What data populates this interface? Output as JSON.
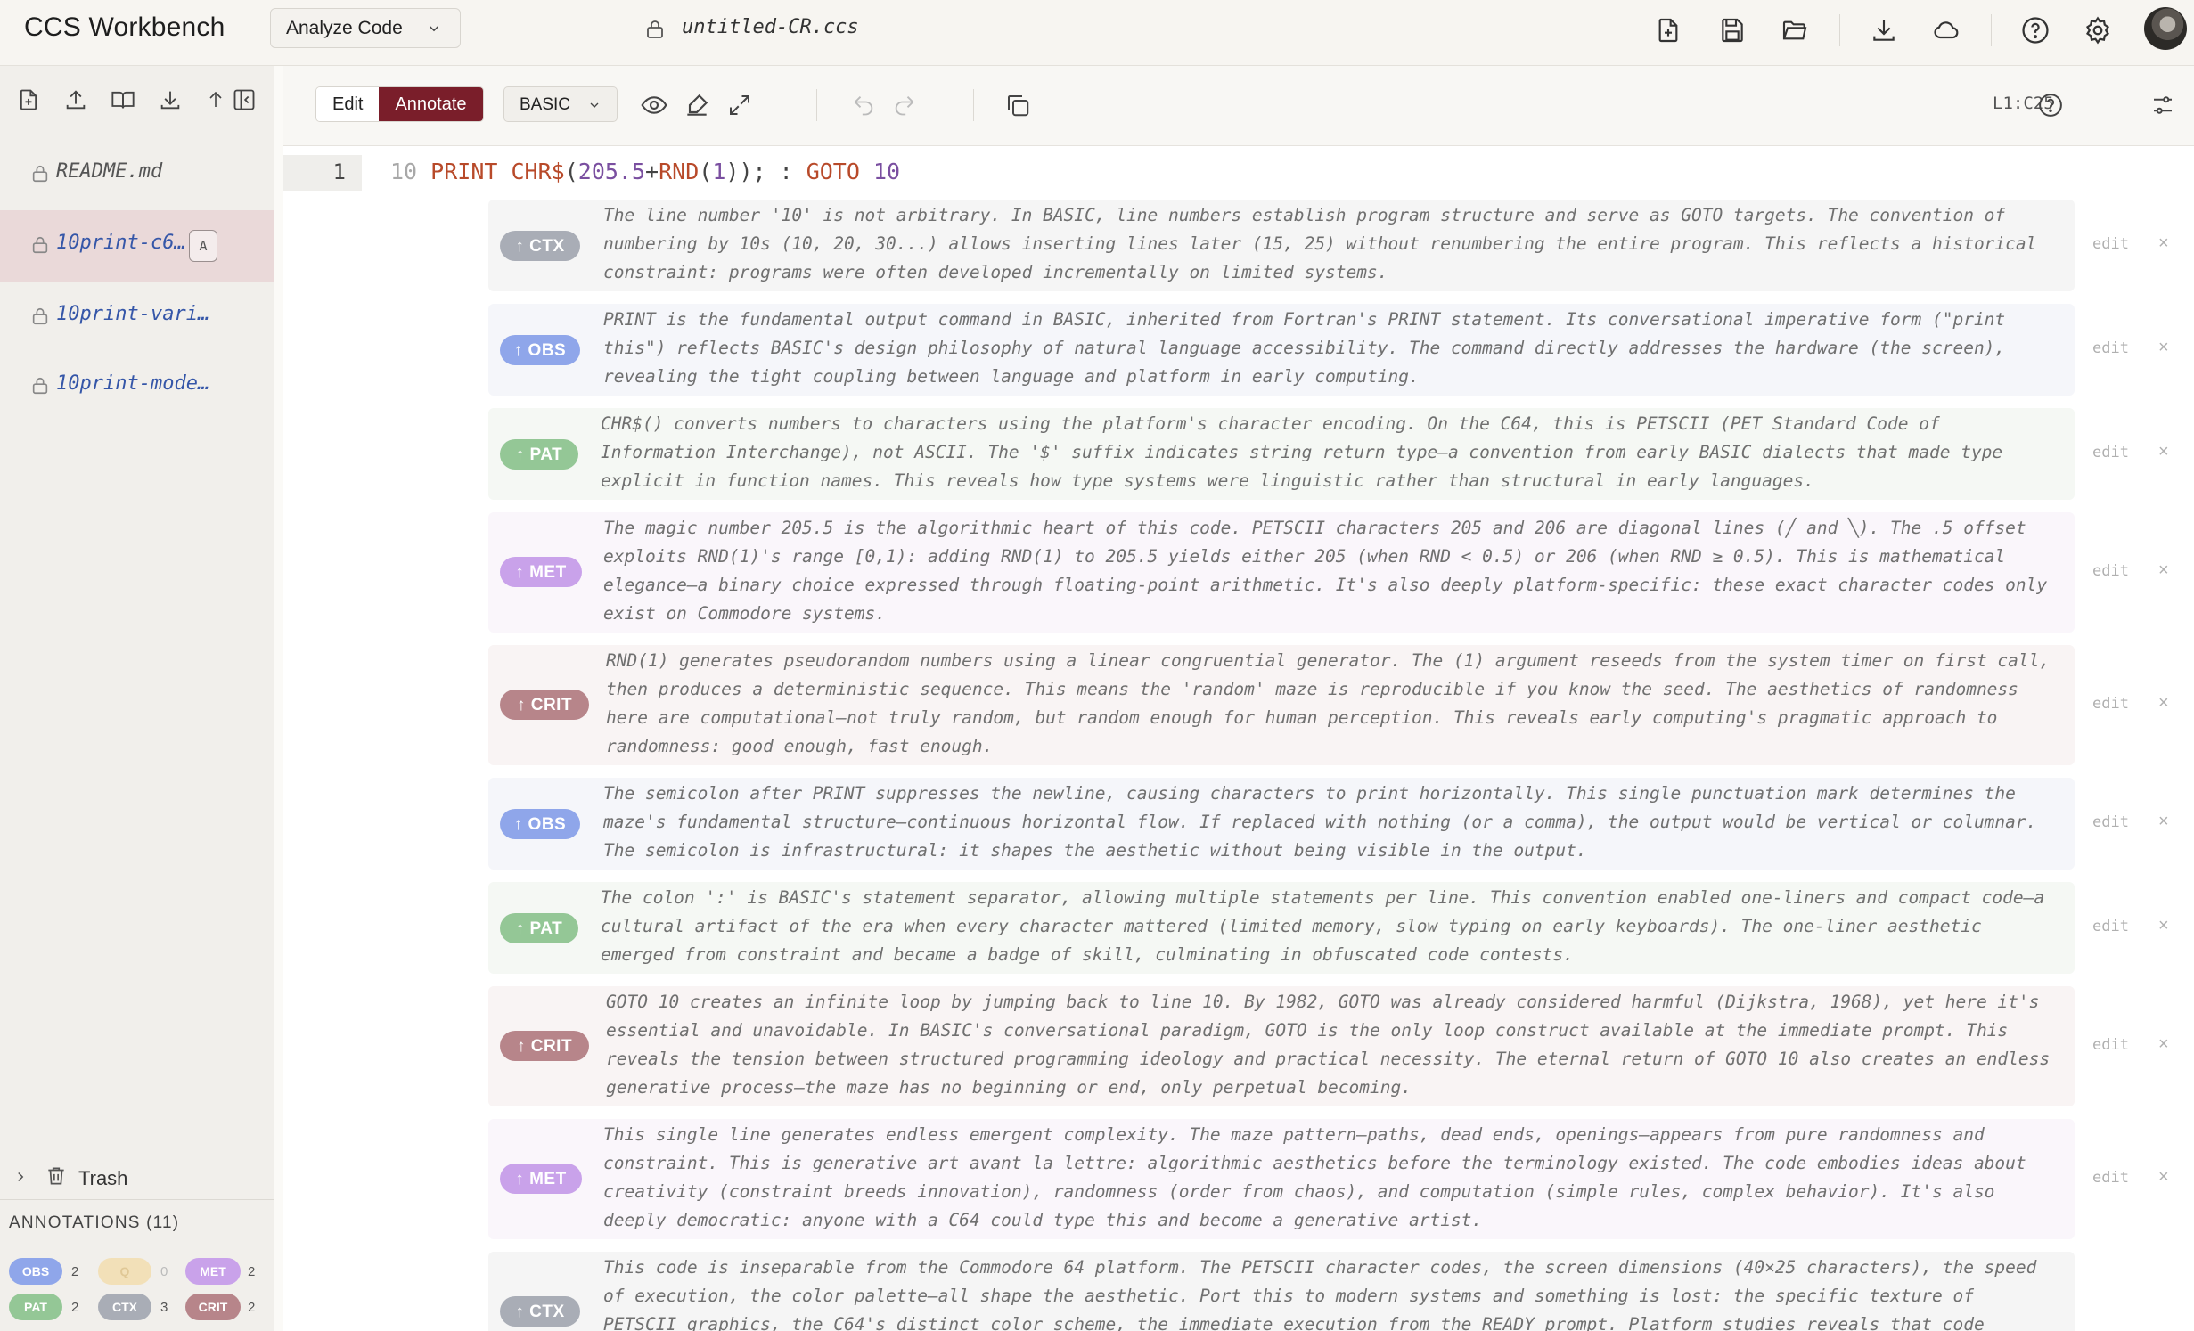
{
  "app": {
    "title": "CCS Workbench",
    "mode_select": "Analyze Code",
    "filename": "untitled-CR.ccs"
  },
  "topbar_icons": [
    "new-file-icon",
    "save-icon",
    "folder-open-icon",
    "download-icon",
    "cloud-icon",
    "help-icon",
    "settings-icon"
  ],
  "sidebar": {
    "tool_icons": [
      "new-file-icon",
      "upload-icon",
      "book-icon",
      "download-icon",
      "arrow-up-icon",
      "collapse-sidebar-icon"
    ],
    "files": [
      {
        "name": "README.md",
        "active": false,
        "badge": ""
      },
      {
        "name": "10print-c6…",
        "active": true,
        "badge": "A"
      },
      {
        "name": "10print-vari…",
        "active": false,
        "badge": ""
      },
      {
        "name": "10print-mode…",
        "active": false,
        "badge": ""
      }
    ],
    "trash_label": "Trash",
    "annotations_title": "ANNOTATIONS (11)",
    "annotation_counts": [
      {
        "label": "OBS",
        "count": "2"
      },
      {
        "label": "Q",
        "count": "0"
      },
      {
        "label": "MET",
        "count": "2"
      },
      {
        "label": "PAT",
        "count": "2"
      },
      {
        "label": "CTX",
        "count": "3"
      },
      {
        "label": "CRIT",
        "count": "2"
      }
    ]
  },
  "editor": {
    "mode_edit": "Edit",
    "mode_annotate": "Annotate",
    "language": "BASIC",
    "cursor_position": "L1:C25",
    "line_number": "1",
    "code": {
      "line_no": "10",
      "print": "PRINT",
      "chr": "CHR$",
      "open": "(",
      "num1": "205.5",
      "plus": "+",
      "rnd": "RND",
      "open2": "(",
      "num2": "1",
      "close": "));",
      "colon": " : ",
      "goto": "GOTO",
      "target": "10"
    },
    "edit_label": "edit",
    "close_label": "×",
    "annotations": [
      {
        "type": "CTX",
        "tag": "↑ CTX",
        "text": "The line number '10' is not arbitrary. In BASIC, line numbers establish program structure and serve as GOTO targets. The convention of numbering by 10s (10, 20, 30...) allows inserting lines later (15, 25) without renumbering the entire program. This reflects a historical constraint: programs were often developed incrementally on limited systems."
      },
      {
        "type": "OBS",
        "tag": "↑ OBS",
        "text": "PRINT is the fundamental output command in BASIC, inherited from Fortran's PRINT statement. Its conversational imperative form (\"print this\") reflects BASIC's design philosophy of natural language accessibility. The command directly addresses the hardware (the screen), revealing the tight coupling between language and platform in early computing."
      },
      {
        "type": "PAT",
        "tag": "↑ PAT",
        "text": "CHR$() converts numbers to characters using the platform's character encoding. On the C64, this is PETSCII (PET Standard Code of Information Interchange), not ASCII. The '$' suffix indicates string return type—a convention from early BASIC dialects that made type explicit in function names. This reveals how type systems were linguistic rather than structural in early languages."
      },
      {
        "type": "MET",
        "tag": "↑ MET",
        "text": "The magic number 205.5 is the algorithmic heart of this code. PETSCII characters 205 and 206 are diagonal lines (╱ and ╲). The .5 offset exploits RND(1)'s range [0,1): adding RND(1) to 205.5 yields either 205 (when RND < 0.5) or 206 (when RND ≥ 0.5). This is mathematical elegance—a binary choice expressed through floating-point arithmetic. It's also deeply platform-specific: these exact character codes only exist on Commodore systems."
      },
      {
        "type": "CRIT",
        "tag": "↑ CRIT",
        "text": "RND(1) generates pseudorandom numbers using a linear congruential generator. The (1) argument reseeds from the system timer on first call, then produces a deterministic sequence. This means the 'random' maze is reproducible if you know the seed. The aesthetics of randomness here are computational—not truly random, but random enough for human perception. This reveals early computing's pragmatic approach to randomness: good enough, fast enough."
      },
      {
        "type": "OBS",
        "tag": "↑ OBS",
        "text": "The semicolon after PRINT suppresses the newline, causing characters to print horizontally. This single punctuation mark determines the maze's fundamental structure—continuous horizontal flow. If replaced with nothing (or a comma), the output would be vertical or columnar. The semicolon is infrastructural: it shapes the aesthetic without being visible in the output."
      },
      {
        "type": "PAT",
        "tag": "↑ PAT",
        "text": "The colon ':' is BASIC's statement separator, allowing multiple statements per line. This convention enabled one-liners and compact code—a cultural artifact of the era when every character mattered (limited memory, slow typing on early keyboards). The one-liner aesthetic emerged from constraint and became a badge of skill, culminating in obfuscated code contests."
      },
      {
        "type": "CRIT",
        "tag": "↑ CRIT",
        "text": "GOTO 10 creates an infinite loop by jumping back to line 10. By 1982, GOTO was already considered harmful (Dijkstra, 1968), yet here it's essential and unavoidable. In BASIC's conversational paradigm, GOTO is the only loop construct available at the immediate prompt. This reveals the tension between structured programming ideology and practical necessity. The eternal return of GOTO 10 also creates an endless generative process—the maze has no beginning or end, only perpetual becoming."
      },
      {
        "type": "MET",
        "tag": "↑ MET",
        "text": "This single line generates endless emergent complexity. The maze pattern—paths, dead ends, openings—appears from pure randomness and constraint. This is generative art avant la lettre: algorithmic aesthetics before the terminology existed. The code embodies ideas about creativity (constraint breeds innovation), randomness (order from chaos), and computation (simple rules, complex behavior). It's also deeply democratic: anyone with a C64 could type this and become a generative artist."
      },
      {
        "type": "CTX",
        "tag": "↑ CTX",
        "text": "This code is inseparable from the Commodore 64 platform. The PETSCII character codes, the screen dimensions (40×25 characters), the speed of execution, the color palette—all shape the aesthetic. Port this to modern systems and something is lost: the specific texture of PETSCII graphics, the C64's distinct color scheme, the immediate execution from the READY prompt. Platform studies reveals that code"
      }
    ]
  },
  "colors": {
    "accent": "#7a1e2a",
    "ctx": "#a9adb6",
    "obs": "#8fa6ea",
    "pat": "#94c796",
    "met": "#c9a2ea",
    "crit": "#b7858a",
    "link": "#3556a8"
  }
}
